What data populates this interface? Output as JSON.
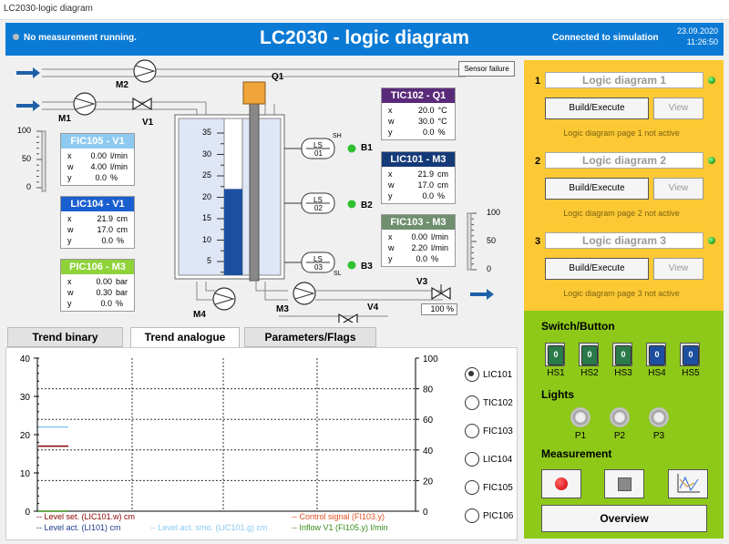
{
  "window": {
    "title": "LC2030-logic diagram"
  },
  "header": {
    "status": "No measurement running.",
    "title": "LC2030 - logic diagram",
    "connection": "Connected to simulation",
    "date": "23.09.2020",
    "time": "11:26:50",
    "color": "#0a7ad4"
  },
  "process": {
    "sensor_failure": "Sensor failure",
    "labels": {
      "q1": "Q1",
      "m1": "M1",
      "m2": "M2",
      "v1": "V1",
      "m3": "M3",
      "m4": "M4",
      "v3": "V3",
      "v4": "V4",
      "b1": "B1",
      "b2": "B2",
      "b3": "B3",
      "sh": "SH",
      "sl": "SL",
      "ls1": "LS",
      "ls1n": "01",
      "ls2": "LS",
      "ls2n": "02",
      "ls3": "LS",
      "ls3n": "03",
      "v3_value": "100 %"
    },
    "tank_scale": [
      "35",
      "30",
      "25",
      "20",
      "15",
      "10",
      "5"
    ],
    "tank_level_pct": 55,
    "left_scale": [
      "100",
      "50",
      "0"
    ],
    "right_scale": [
      "100",
      "50",
      "0"
    ],
    "controllers": [
      {
        "id": "fic105",
        "title": "FIC105 - V1",
        "color": "#8ecaf0",
        "textcolor": "#fff",
        "rows": [
          [
            "x",
            "0.00",
            "l/min"
          ],
          [
            "w",
            "4.00",
            "l/min"
          ],
          [
            "y",
            "0.0",
            "%"
          ]
        ]
      },
      {
        "id": "lic104",
        "title": "LIC104 - V1",
        "color": "#1a5fd0",
        "textcolor": "#fff",
        "rows": [
          [
            "x",
            "21.9",
            "cm"
          ],
          [
            "w",
            "17.0",
            "cm"
          ],
          [
            "y",
            "0.0",
            "%"
          ]
        ]
      },
      {
        "id": "pic106",
        "title": "PIC106 - M3",
        "color": "#8fd23a",
        "textcolor": "#fff",
        "rows": [
          [
            "x",
            "0.00",
            "bar"
          ],
          [
            "w",
            "0.30",
            "bar"
          ],
          [
            "y",
            "0.0",
            "%"
          ]
        ]
      },
      {
        "id": "tic102",
        "title": "TIC102 - Q1",
        "color": "#5a2a7a",
        "textcolor": "#fff",
        "rows": [
          [
            "x",
            "20.0",
            "°C"
          ],
          [
            "w",
            "30.0",
            "°C"
          ],
          [
            "y",
            "0.0",
            "%"
          ]
        ]
      },
      {
        "id": "lic101",
        "title": "LIC101 - M3",
        "color": "#153a78",
        "textcolor": "#fff",
        "rows": [
          [
            "x",
            "21.9",
            "cm"
          ],
          [
            "w",
            "17.0",
            "cm"
          ],
          [
            "y",
            "0.0",
            "%"
          ]
        ]
      },
      {
        "id": "fic103",
        "title": "FIC103 - M3",
        "color": "#6f8f6f",
        "textcolor": "#fff",
        "rows": [
          [
            "x",
            "0.00",
            "l/min"
          ],
          [
            "w",
            "2.20",
            "l/min"
          ],
          [
            "y",
            "0.0",
            "%"
          ]
        ]
      }
    ]
  },
  "logic": {
    "color": "#fcc934",
    "items": [
      {
        "num": "1",
        "name": "Logic diagram 1",
        "build": "Build/Execute",
        "view": "View",
        "note": "Logic diagram page 1 not active"
      },
      {
        "num": "2",
        "name": "Logic diagram 2",
        "build": "Build/Execute",
        "view": "View",
        "note": "Logic diagram page 2 not active"
      },
      {
        "num": "3",
        "name": "Logic diagram 3",
        "build": "Build/Execute",
        "view": "View",
        "note": "Logic diagram page 3 not active"
      }
    ]
  },
  "panel": {
    "color": "#8ec919",
    "switch_title": "Switch/Button",
    "switches": [
      {
        "label": "HS1",
        "state": "0",
        "color": "#2a7a4a"
      },
      {
        "label": "HS2",
        "state": "0",
        "color": "#2a7a4a"
      },
      {
        "label": "HS3",
        "state": "0",
        "color": "#2a7a4a"
      },
      {
        "label": "HS4",
        "state": "0",
        "color": "#1d4fa0"
      },
      {
        "label": "HS5",
        "state": "0",
        "color": "#1d4fa0"
      }
    ],
    "lights_title": "Lights",
    "lights": [
      "P1",
      "P2",
      "P3"
    ],
    "measurement_title": "Measurement",
    "overview": "Overview"
  },
  "tabs": [
    {
      "label": "Trend binary",
      "active": false
    },
    {
      "label": "Trend analogue",
      "active": true
    },
    {
      "label": "Parameters/Flags",
      "active": false
    }
  ],
  "chart_data": {
    "type": "line",
    "left_axis": {
      "ticks": [
        "40",
        "30",
        "20",
        "10",
        "0"
      ],
      "ylim": [
        0,
        40
      ]
    },
    "right_axis": {
      "ticks": [
        "100",
        "80",
        "60",
        "40",
        "20",
        "0"
      ],
      "ylim": [
        0,
        100
      ]
    },
    "series": [
      {
        "name": "-- Level set. (LIC101.w) cm",
        "color": "#8b0000",
        "y": 17
      },
      {
        "name": "-- Level act. (LI101) cm",
        "color": "#1a3a8a",
        "y": null
      },
      {
        "name": "-- Level act. smo. (LIC101.g) cm",
        "color": "#87c8ee",
        "y": 22
      },
      {
        "name": "-- Control signal (FI103.y)",
        "color": "#e05020",
        "y": null
      },
      {
        "name": "-- Inflow V1 (FI105.y) l/min",
        "color": "#3a8a1a",
        "y": 0
      }
    ]
  },
  "trend_select": [
    {
      "label": "LIC101",
      "on": true
    },
    {
      "label": "TIC102",
      "on": false
    },
    {
      "label": "FIC103",
      "on": false
    },
    {
      "label": "LIC104",
      "on": false
    },
    {
      "label": "FIC105",
      "on": false
    },
    {
      "label": "PIC106",
      "on": false
    }
  ]
}
